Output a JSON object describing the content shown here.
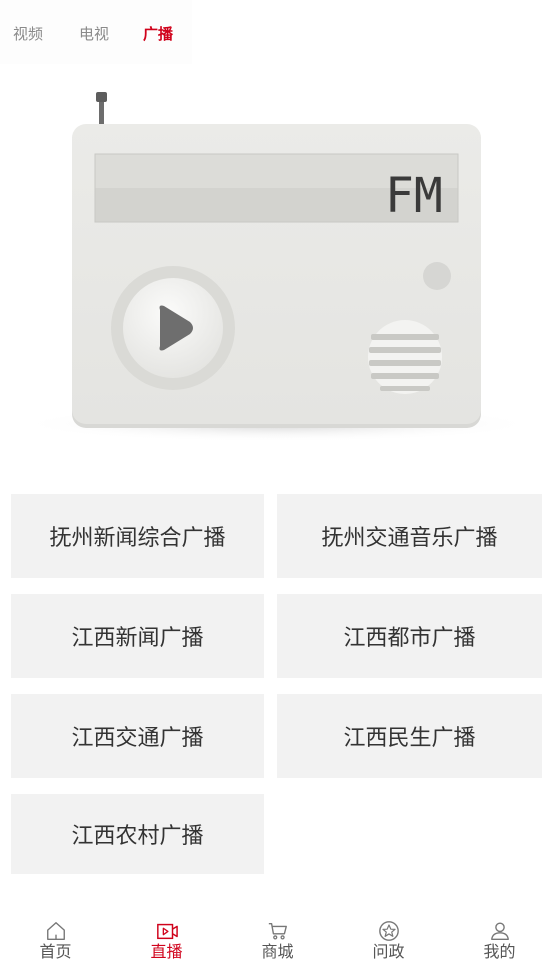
{
  "top_tabs": [
    {
      "label": "视频",
      "active": false
    },
    {
      "label": "电视",
      "active": false
    },
    {
      "label": "广播",
      "active": true
    }
  ],
  "radio": {
    "display_text": "FM",
    "play_icon": "play-icon"
  },
  "stations": [
    {
      "label": "抚州新闻综合广播"
    },
    {
      "label": "抚州交通音乐广播"
    },
    {
      "label": "江西新闻广播"
    },
    {
      "label": "江西都市广播"
    },
    {
      "label": "江西交通广播"
    },
    {
      "label": "江西民生广播"
    },
    {
      "label": "江西农村广播"
    }
  ],
  "bottom_nav": [
    {
      "label": "首页",
      "icon": "home-icon",
      "active": false
    },
    {
      "label": "直播",
      "icon": "live-video-icon",
      "active": true
    },
    {
      "label": "商城",
      "icon": "cart-icon",
      "active": false
    },
    {
      "label": "问政",
      "icon": "star-badge-icon",
      "active": false
    },
    {
      "label": "我的",
      "icon": "user-icon",
      "active": false
    }
  ],
  "colors": {
    "accent": "#d0021b",
    "tile_bg": "#f2f2f2",
    "text": "#333333",
    "inactive_tab": "#8a8a8a"
  }
}
